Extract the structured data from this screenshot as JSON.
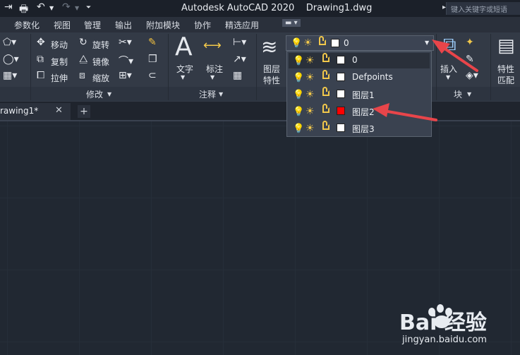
{
  "title_bar": {
    "app_title": "Autodesk AutoCAD 2020    Drawing1.dwg",
    "search_placeholder": "键入关键字或短语"
  },
  "menu": {
    "tabs": [
      "参数化",
      "视图",
      "管理",
      "输出",
      "附加模块",
      "协作",
      "精选应用"
    ]
  },
  "ribbon": {
    "modify": {
      "move": "移动",
      "rotate": "旋转",
      "copy": "复制",
      "mirror": "镜像",
      "stretch": "拉伸",
      "scale": "缩放",
      "panel_title": "修改"
    },
    "annotation": {
      "text": "文字",
      "dimension": "标注",
      "panel_title": "注释"
    },
    "layers": {
      "properties_line1": "图层",
      "properties_line2": "特性"
    },
    "block": {
      "insert": "插入",
      "panel_title": "块"
    },
    "properties": {
      "match_line1": "特性",
      "match_line2": "匹配"
    }
  },
  "layer_dropdown": {
    "current_layer": "0",
    "current_color": "#ffffff",
    "items": [
      {
        "name": "0",
        "color": "#ffffff"
      },
      {
        "name": "Defpoints",
        "color": "#ffffff"
      },
      {
        "name": "图层1",
        "color": "#ffffff"
      },
      {
        "name": "图层2",
        "color": "#ff0000"
      },
      {
        "name": "图层3",
        "color": "#ffffff"
      }
    ]
  },
  "document_tabs": {
    "active": "rawing1*",
    "close_icon": "close-icon",
    "new_tab_icon": "plus-icon"
  },
  "watermark": {
    "brand": "Bai 经验",
    "url": "jingyan.baidu.com"
  },
  "colors": {
    "accent_arrow": "#e8454a",
    "bulb": "#f2c84b"
  }
}
